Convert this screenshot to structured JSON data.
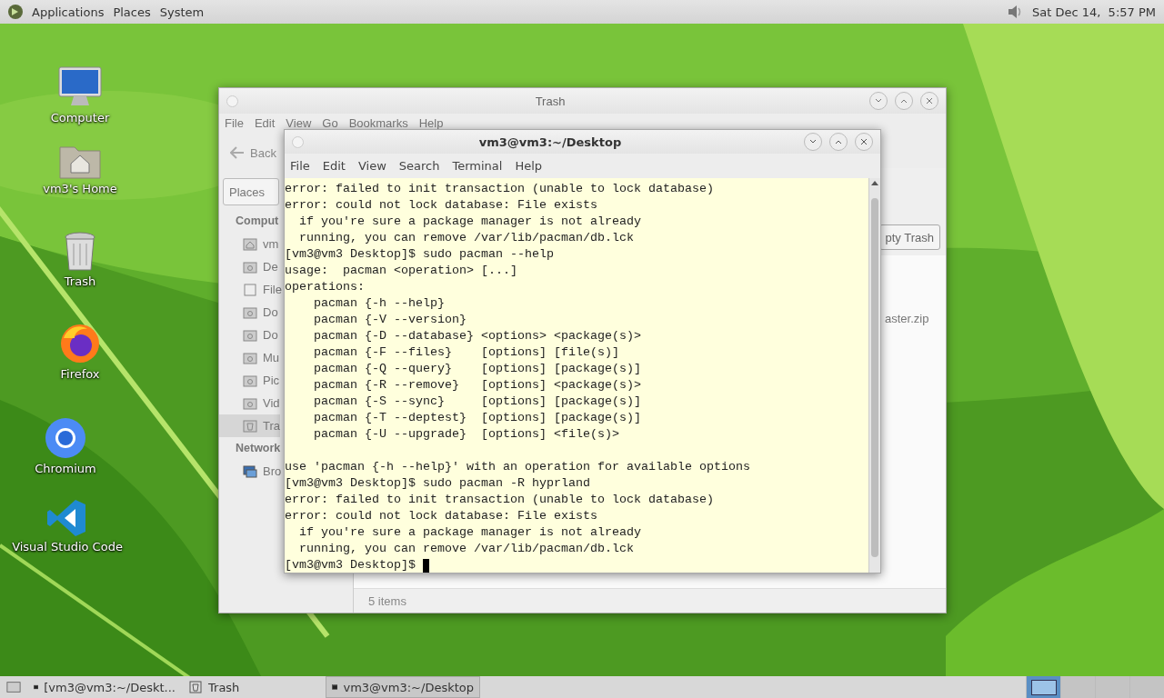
{
  "top_panel": {
    "menus": [
      "Applications",
      "Places",
      "System"
    ],
    "clock": "Sat Dec 14,  5:57 PM"
  },
  "desktop_icons": [
    {
      "kind": "computer",
      "label": "Computer"
    },
    {
      "kind": "home",
      "label": "vm3's Home"
    },
    {
      "kind": "trash",
      "label": "Trash"
    },
    {
      "kind": "firefox",
      "label": "Firefox"
    },
    {
      "kind": "chromium",
      "label": "Chromium"
    },
    {
      "kind": "vscode",
      "label": "Visual Studio Code"
    }
  ],
  "file_manager": {
    "title": "Trash",
    "menu": [
      "File",
      "Edit",
      "View",
      "Go",
      "Bookmarks",
      "Help"
    ],
    "back_button": "Back",
    "places_dropdown": "Places",
    "sidebar": [
      {
        "kind": "header",
        "label": "Comput"
      },
      {
        "kind": "item",
        "label": "vm",
        "selected": false
      },
      {
        "kind": "item",
        "label": "De",
        "selected": false
      },
      {
        "kind": "item",
        "label": "File",
        "selected": false
      },
      {
        "kind": "item",
        "label": "Do",
        "selected": false
      },
      {
        "kind": "item",
        "label": "Do",
        "selected": false
      },
      {
        "kind": "item",
        "label": "Mu",
        "selected": false
      },
      {
        "kind": "item",
        "label": "Pic",
        "selected": false
      },
      {
        "kind": "item",
        "label": "Vid",
        "selected": false
      },
      {
        "kind": "item",
        "label": "Tra",
        "selected": true
      },
      {
        "kind": "header",
        "label": "Network"
      },
      {
        "kind": "item",
        "label": "Bro",
        "selected": false
      }
    ],
    "empty_trash_button": "pty Trash",
    "files": [
      {
        "name": "aster.zip"
      }
    ],
    "status": "5 items"
  },
  "terminal": {
    "title": "vm3@vm3:~/Desktop",
    "menu": [
      "File",
      "Edit",
      "View",
      "Search",
      "Terminal",
      "Help"
    ],
    "lines": [
      {
        "text": "error: failed to init transaction (unable to lock database)"
      },
      {
        "text": "error: could not lock database: File exists"
      },
      {
        "text": "  if you're sure a package manager is not already"
      },
      {
        "text": "  running, you can remove /var/lib/pacman/db.lck"
      },
      {
        "text": "[vm3@vm3 Desktop]$ sudo pacman --help"
      },
      {
        "text": "usage:  pacman <operation> [...]"
      },
      {
        "text": "operations:"
      },
      {
        "text": "    pacman {-h --help}"
      },
      {
        "text": "    pacman {-V --version}"
      },
      {
        "text": "    pacman {-D --database} <options> <package(s)>"
      },
      {
        "text": "    pacman {-F --files}    [options] [file(s)]"
      },
      {
        "text": "    pacman {-Q --query}    [options] [package(s)]"
      },
      {
        "text": "    pacman {-R --remove}   [options] <package(s)>"
      },
      {
        "text": "    pacman {-S --sync}     [options] [package(s)]"
      },
      {
        "text": "    pacman {-T --deptest}  [options] [package(s)]"
      },
      {
        "text": "    pacman {-U --upgrade}  [options] <file(s)>"
      },
      {
        "text": "use 'pacman {-h --help}' with an operation for available options",
        "space_before": true
      },
      {
        "text": "[vm3@vm3 Desktop]$ sudo pacman -R hyprland"
      },
      {
        "text": "error: failed to init transaction (unable to lock database)"
      },
      {
        "text": "error: could not lock database: File exists"
      },
      {
        "text": "  if you're sure a package manager is not already"
      },
      {
        "text": "  running, you can remove /var/lib/pacman/db.lck"
      },
      {
        "text": "[vm3@vm3 Desktop]$ ",
        "cursor": true
      }
    ]
  },
  "taskbar": {
    "tasks": [
      {
        "kind": "terminal",
        "label": "[vm3@vm3:~/Deskt...",
        "selected": false
      },
      {
        "kind": "files",
        "label": "Trash",
        "selected": false
      },
      {
        "kind": "terminal",
        "label": "vm3@vm3:~/Desktop",
        "selected": true
      }
    ],
    "workspaces": [
      {
        "selected": true
      },
      {
        "selected": false
      },
      {
        "selected": false
      },
      {
        "selected": false
      }
    ]
  }
}
